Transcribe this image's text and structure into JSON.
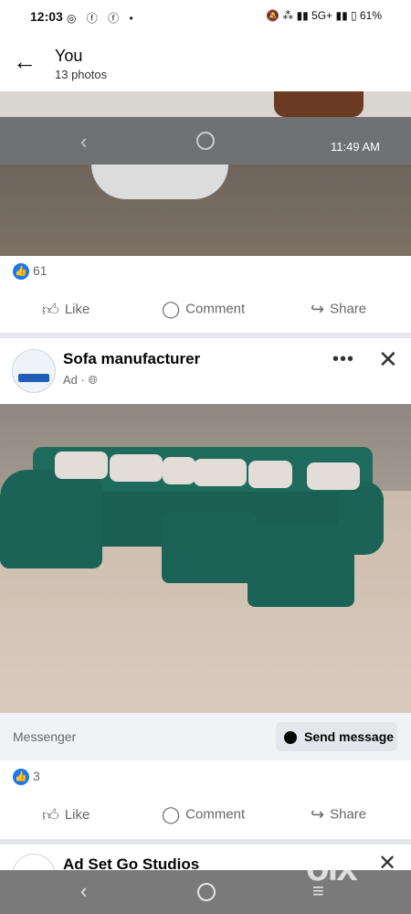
{
  "status_bar": {
    "time": "12:03",
    "left_icons": [
      "whatsapp-icon",
      "messenger-icon",
      "facebook-icon",
      "dot"
    ],
    "network": "5G+",
    "battery": "61%"
  },
  "header": {
    "title": "You",
    "subtitle": "13 photos"
  },
  "photo1_overlay": {
    "time": "11:49 AM"
  },
  "post1": {
    "reaction_count": "61"
  },
  "actions": {
    "like": "Like",
    "comment": "Comment",
    "share": "Share"
  },
  "post2": {
    "author": "Sofa manufacturer",
    "meta": "Ad ·",
    "messenger_label": "Messenger",
    "send_button": "Send message",
    "reaction_count": "3"
  },
  "post3": {
    "author": "Ad Set Go Studios"
  },
  "watermark": "olx",
  "colors": {
    "facebook_blue": "#1877f2",
    "sofa_green": "#1b6356",
    "nav_gray": "#7a7a7a"
  }
}
